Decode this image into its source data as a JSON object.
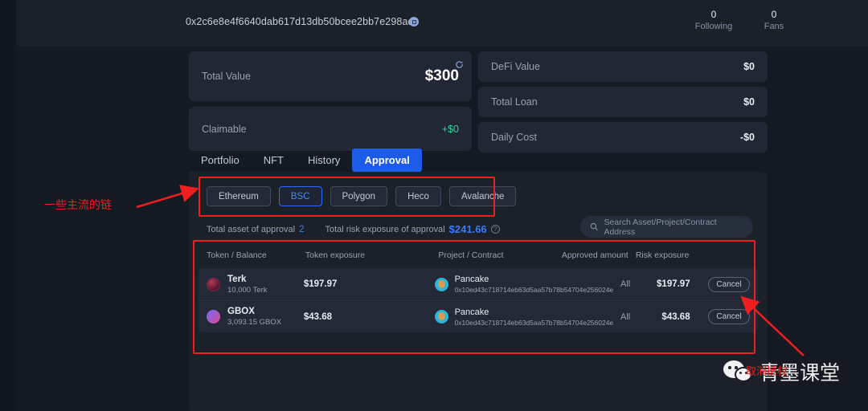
{
  "header": {
    "wallet_address": "0x2c6e8e4f6640dab617d13db50bcee2bb7e298ade",
    "copy_icon": "copy-icon",
    "stats": [
      {
        "value": "0",
        "label": "Following"
      },
      {
        "value": "0",
        "label": "Fans"
      }
    ]
  },
  "summary_cards": [
    {
      "label": "Total Value",
      "value": "$300"
    },
    {
      "label": "Claimable",
      "value": "+$0"
    },
    {
      "label": "DeFi Value",
      "value": "$0"
    },
    {
      "label": "Total Loan",
      "value": "$0"
    },
    {
      "label": "Daily Cost",
      "value": "-$0"
    }
  ],
  "refresh_icon": "refresh-icon",
  "tabs": [
    {
      "label": "Portfolio",
      "active": false
    },
    {
      "label": "NFT",
      "active": false
    },
    {
      "label": "History",
      "active": false
    },
    {
      "label": "Approval",
      "active": true
    }
  ],
  "chains": [
    {
      "label": "Ethereum",
      "selected": false
    },
    {
      "label": "BSC",
      "selected": true
    },
    {
      "label": "Polygon",
      "selected": false
    },
    {
      "label": "Heco",
      "selected": false
    },
    {
      "label": "Avalanche",
      "selected": false
    }
  ],
  "approval_summary": {
    "asset_label": "Total asset of approval",
    "asset_count": "2",
    "risk_label": "Total risk exposure of approval",
    "risk_amount": "$241.66",
    "help_icon": "question-mark-icon"
  },
  "search": {
    "icon": "search-icon",
    "placeholder": "Search Asset/Project/Contract Address",
    "value": ""
  },
  "table": {
    "headers": {
      "token": "Token / Balance",
      "exposure": "Token exposure",
      "project": "Project / Contract",
      "approved": "Approved amount",
      "risk": "Risk exposure"
    },
    "rows": [
      {
        "token_icon": "terk-token-icon",
        "token_name": "Terk",
        "token_balance": "10,000 Terk",
        "token_exposure": "$197.97",
        "project_icon": "pancake-icon",
        "project_name": "Pancake",
        "contract_address": "0x10ed43c718714eb63d5aa57b78b54704e256024e",
        "approved_amount": "All",
        "risk_exposure": "$197.97",
        "action_label": "Cancel"
      },
      {
        "token_icon": "gbox-token-icon",
        "token_name": "GBOX",
        "token_balance": "3,093.15 GBOX",
        "token_exposure": "$43.68",
        "project_icon": "pancake-icon",
        "project_name": "Pancake",
        "contract_address": "0x10ed43c718714eb63d5aa57b78b54704e256024e",
        "approved_amount": "All",
        "risk_exposure": "$43.68",
        "action_label": "Cancel"
      }
    ]
  },
  "annotations": {
    "chains_note": "一些主流的链",
    "cancel_note": "取消授权",
    "highlight_color": "#f01f1f"
  },
  "watermark": {
    "logo": "wechat-logo",
    "text": "青墨课堂"
  }
}
